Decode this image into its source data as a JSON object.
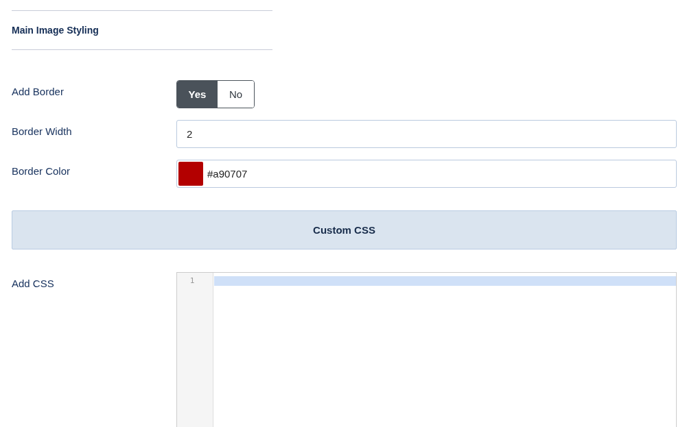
{
  "section_heading": "Main Image Styling",
  "fields": [
    {
      "kind": "toggle",
      "label": "Add Border",
      "options": [
        {
          "label": "Yes",
          "selected": true
        },
        {
          "label": "No",
          "selected": false
        }
      ]
    },
    {
      "kind": "text",
      "label": "Border Width",
      "value": "2"
    },
    {
      "kind": "color",
      "label": "Border Color",
      "value": "#a90707",
      "color": "#b30000"
    }
  ],
  "custom_css": {
    "header": "Custom CSS",
    "label": "Add CSS",
    "editor": {
      "line_numbers": [
        "1"
      ]
    }
  }
}
